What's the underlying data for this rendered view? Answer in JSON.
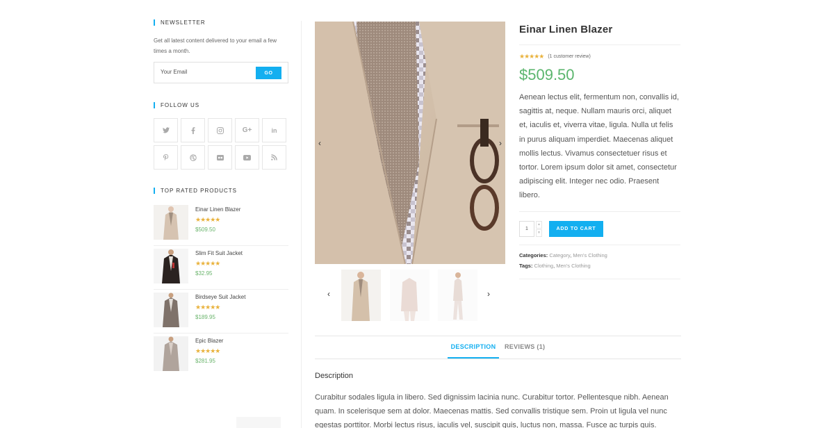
{
  "newsletter": {
    "title": "NEWSLETTER",
    "text": "Get all latest content delivered to your email a few times a month.",
    "placeholder": "Your Email",
    "button": "GO"
  },
  "follow": {
    "title": "FOLLOW US",
    "icons": [
      "twitter-icon",
      "facebook-icon",
      "instagram-icon",
      "google-plus-icon",
      "linkedin-icon",
      "pinterest-icon",
      "dribbble-icon",
      "flickr-icon",
      "youtube-icon",
      "rss-icon"
    ]
  },
  "top_rated": {
    "title": "TOP RATED PRODUCTS",
    "items": [
      {
        "name": "Einar Linen Blazer",
        "stars": "★★★★★",
        "price": "$509.50"
      },
      {
        "name": "Slim Fit Suit Jacket",
        "stars": "★★★★★",
        "price": "$32.95"
      },
      {
        "name": "Birdseye Suit Jacket",
        "stars": "★★★★★",
        "price": "$189.95"
      },
      {
        "name": "Epic Blazer",
        "stars": "★★★★★",
        "price": "$281.95"
      }
    ]
  },
  "product": {
    "title": "Einar Linen Blazer",
    "stars": "★★★★★",
    "review_link": "(1 customer review)",
    "price": "$509.50",
    "description": "Aenean lectus elit, fermentum non, convallis id, sagittis at, neque. Nullam mauris orci, aliquet et, iaculis et, viverra vitae, ligula. Nulla ut felis in purus aliquam imperdiet. Maecenas aliquet mollis lectus. Vivamus consectetuer risus et tortor. Lorem ipsum dolor sit amet, consectetur adipiscing elit. Integer nec odio. Praesent libero.",
    "quantity": "1",
    "add_to_cart": "ADD TO CART",
    "categories_label": "Categories:",
    "categories": [
      "Category",
      "Men's Clothing"
    ],
    "tags_label": "Tags:",
    "tags": [
      "Clothing",
      "Men's Clothing"
    ]
  },
  "tabs": {
    "description": "DESCRIPTION",
    "reviews": "REVIEWS (1)"
  },
  "description_section": {
    "heading": "Description",
    "body": "Curabitur sodales ligula in libero. Sed dignissim lacinia nunc. Curabitur tortor. Pellentesque nibh. Aenean quam. In scelerisque sem at dolor. Maecenas mattis. Sed convallis tristique sem. Proin ut ligula vel nunc egestas porttitor. Morbi lectus risus, iaculis vel, suscipit quis, luctus non, massa. Fusce ac turpis quis."
  },
  "colors": {
    "accent": "#13aff0",
    "price": "#5bb56d",
    "star": "#e9b23c"
  }
}
